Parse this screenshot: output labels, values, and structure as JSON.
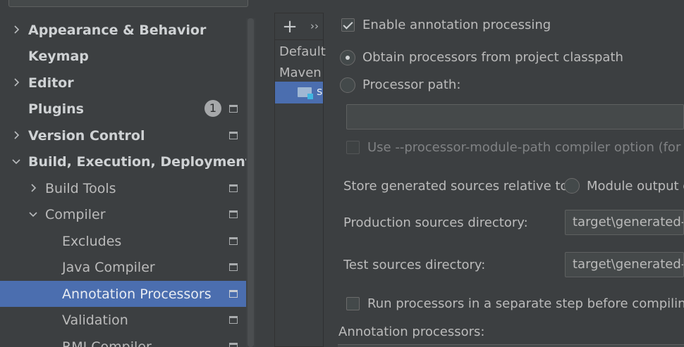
{
  "sidebar": {
    "items": [
      {
        "label": "Appearance & Behavior",
        "expanded": false
      },
      {
        "label": "Keymap"
      },
      {
        "label": "Editor",
        "expanded": false
      },
      {
        "label": "Plugins",
        "badge": "1"
      },
      {
        "label": "Version Control",
        "expanded": false
      },
      {
        "label": "Build, Execution, Deployment",
        "expanded": true
      },
      {
        "label": "Build Tools",
        "expanded": false
      },
      {
        "label": "Compiler",
        "expanded": true
      },
      {
        "label": "Excludes"
      },
      {
        "label": "Java Compiler"
      },
      {
        "label": "Annotation Processors",
        "selected": true
      },
      {
        "label": "Validation"
      },
      {
        "label": "RMI Compiler"
      }
    ]
  },
  "profiles": {
    "add_label": "+",
    "more_label": "››",
    "items": [
      "Default",
      "Maven"
    ],
    "selected_label": "s"
  },
  "options": {
    "enable_processing": "Enable annotation processing",
    "obtain_classpath": "Obtain processors from project classpath",
    "processor_path": "Processor path:",
    "processor_path_value": "",
    "module_path_option": "Use --processor-module-path compiler option (for Ja",
    "store_relative": "Store generated sources relative to:",
    "module_output": "Module output d",
    "production_label": "Production sources directory:",
    "production_value": "target\\generated-s",
    "test_label": "Test sources directory:",
    "test_value": "target\\generated-t",
    "separate_step": "Run processors in a separate step before compiling j",
    "processors_header": "Annotation processors:"
  },
  "colors": {
    "background": "#3c3f41",
    "selection": "#4b6eaf",
    "text": "#bbbbbb"
  }
}
